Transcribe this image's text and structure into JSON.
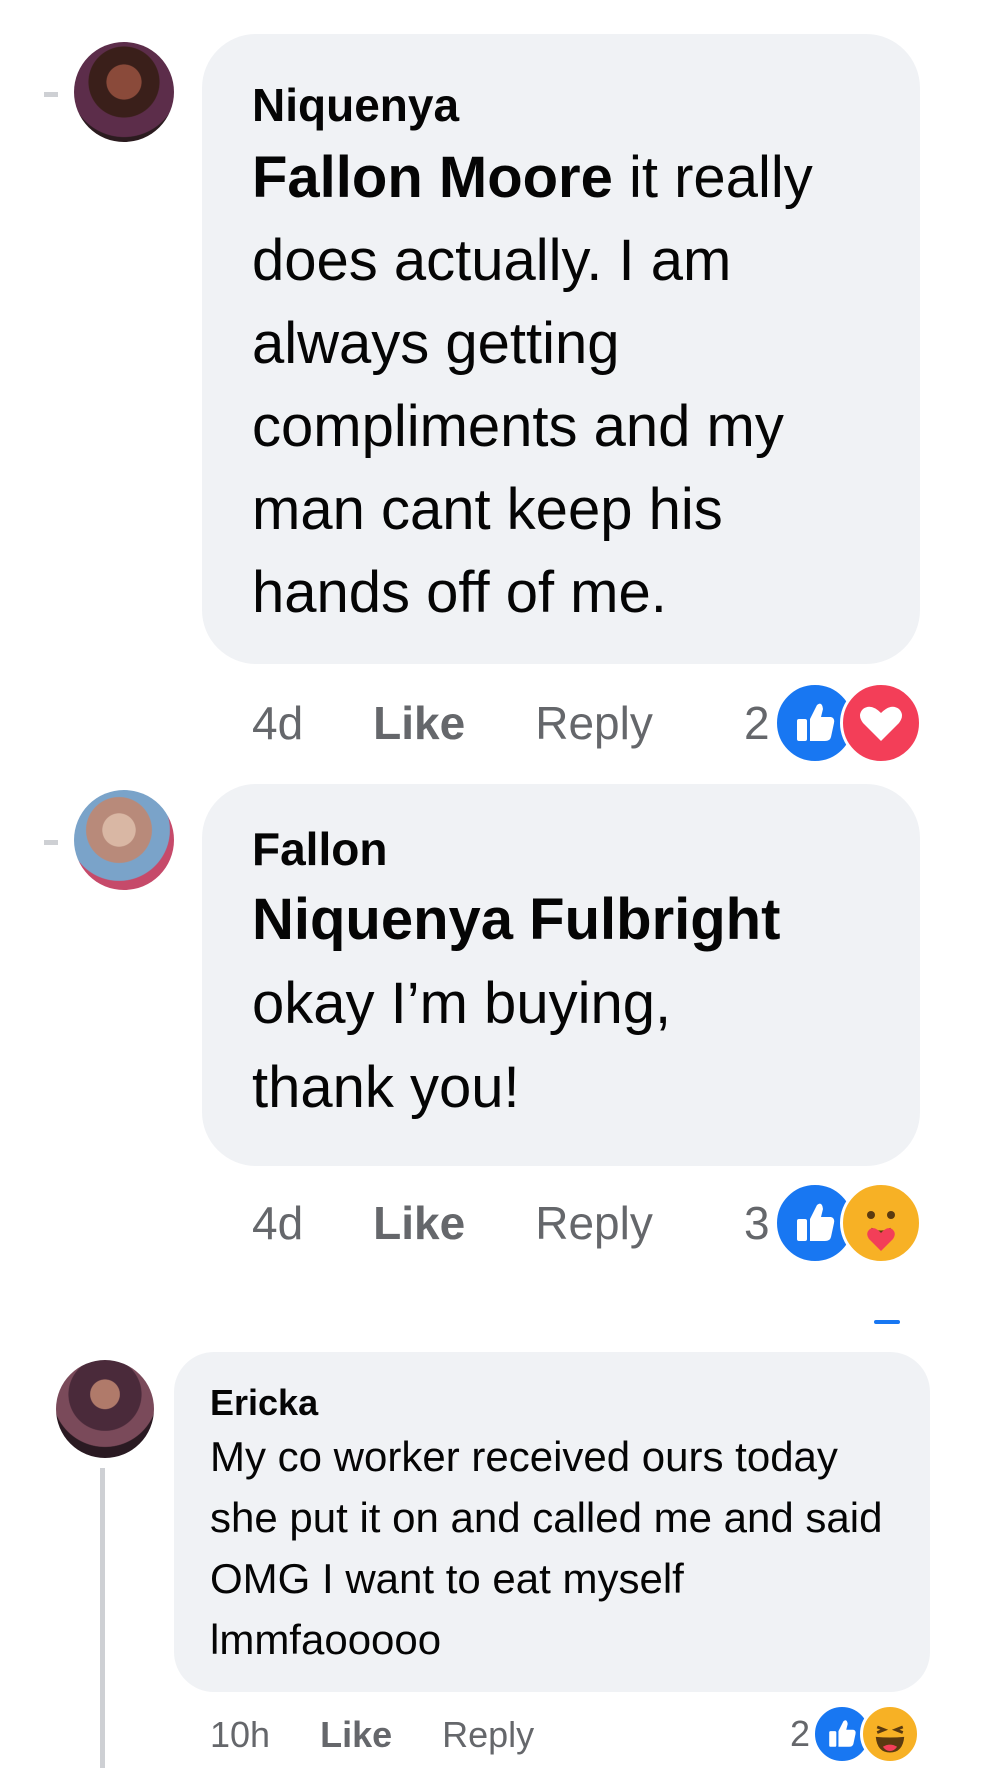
{
  "comments": [
    {
      "author": "Niquenya",
      "tag": "Fallon Moore",
      "text": " it really does actually. I am always getting compliments and my man cant keep his hands off of me.",
      "time": "4d",
      "like_label": "Like",
      "reply_label": "Reply",
      "reaction_count": "2",
      "reactions": [
        "like-icon",
        "love-icon"
      ]
    },
    {
      "author": "Fallon",
      "tag": "Niquenya Fulbright",
      "text": "okay I’m buying, thank you!",
      "time": "4d",
      "like_label": "Like",
      "reply_label": "Reply",
      "reaction_count": "3",
      "reactions": [
        "like-icon",
        "care-icon"
      ]
    },
    {
      "author": "Ericka",
      "text": "My co worker received ours today she put it on and called me and said OMG I want to eat myself lmmfaooooo",
      "time": "10h",
      "like_label": "Like",
      "reply_label": "Reply",
      "reaction_count": "2",
      "reactions": [
        "like-icon",
        "haha-icon"
      ]
    }
  ],
  "colors": {
    "bubble": "#f0f2f5",
    "meta_text": "#65676b",
    "like_blue": "#1877f2",
    "love_red": "#f33e58",
    "emoji_yellow": "#f7b125"
  }
}
